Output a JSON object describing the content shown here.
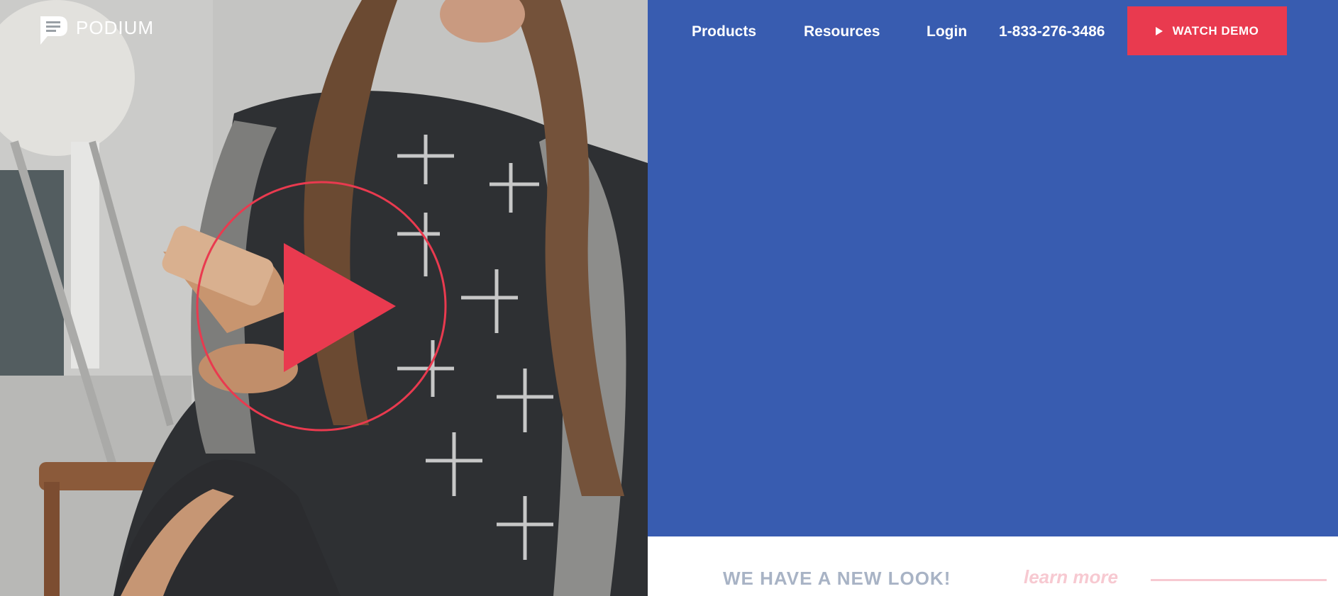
{
  "brand": {
    "name": "PODIUM",
    "logo_icon": "podium-logo-icon"
  },
  "nav": {
    "products": "Products",
    "resources": "Resources",
    "login": "Login",
    "phone": "1-833-276-3486",
    "demo_button": "WATCH DEMO",
    "demo_icon": "play-icon"
  },
  "hero": {
    "video_icon": "play-circle-icon"
  },
  "announcement": {
    "text": "WE HAVE A NEW LOOK!",
    "link": "learn more"
  },
  "colors": {
    "blue_panel": "#385cb0",
    "accent_red": "#e93a4f",
    "announcement_text": "#a8b3c5",
    "learn_more": "#f7c9d1"
  }
}
